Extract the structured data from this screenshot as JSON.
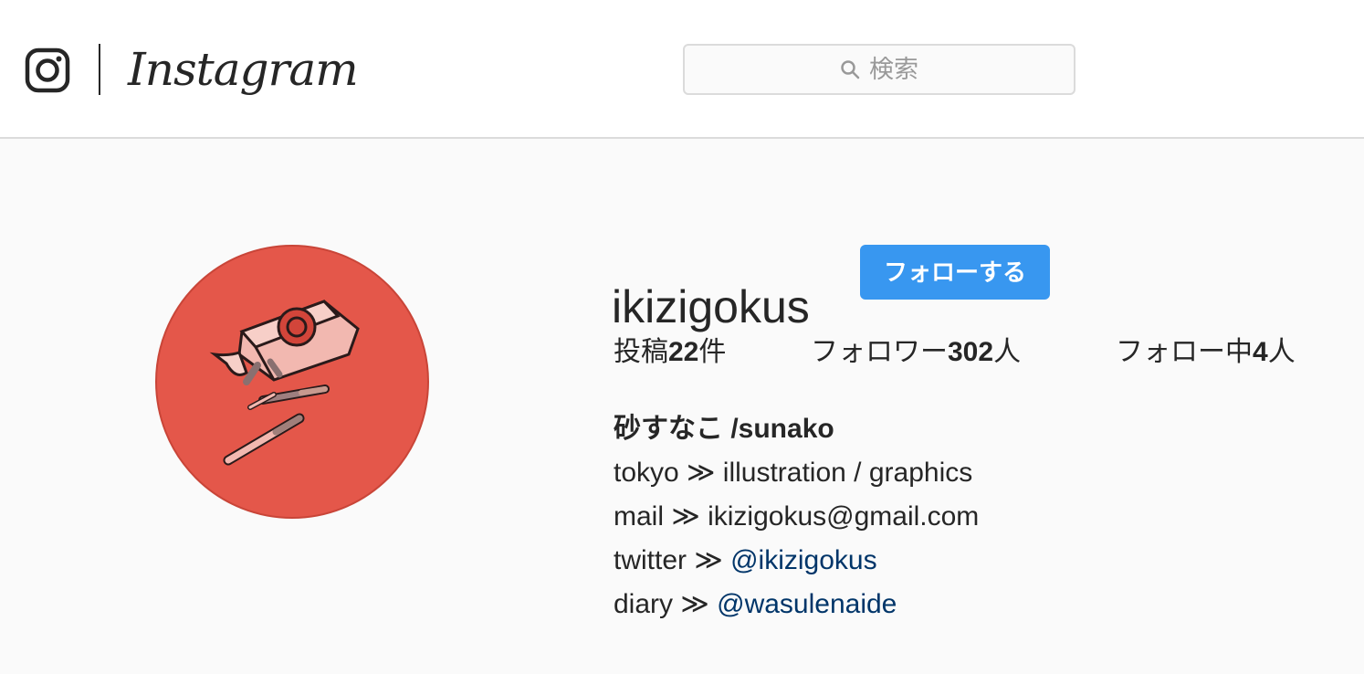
{
  "header": {
    "brand": "Instagram",
    "search": {
      "placeholder": "検索"
    }
  },
  "profile": {
    "username": "ikizigokus",
    "follow_label": "フォローする",
    "stats": {
      "posts_prefix": "投稿",
      "posts_count": "22",
      "posts_suffix": "件",
      "followers_prefix": "フォロワー",
      "followers_count": "302",
      "followers_suffix": "人",
      "following_prefix": "フォロー中",
      "following_count": "4",
      "following_suffix": "人"
    },
    "bio": {
      "name": "砂すなこ /sunako",
      "line1": "tokyo ≫ illustration / graphics",
      "line2": "mail ≫ ikizigokus@gmail.com",
      "line3_prefix": "twitter ≫ ",
      "line3_link": "@ikizigokus",
      "line4_prefix": "diary ≫ ",
      "line4_link": "@wasulenaide"
    }
  },
  "colors": {
    "accent": "#3897f0",
    "link": "#003569",
    "avatar_bg": "#e4574a"
  },
  "icons": [
    "instagram-camera-icon",
    "search-icon"
  ]
}
